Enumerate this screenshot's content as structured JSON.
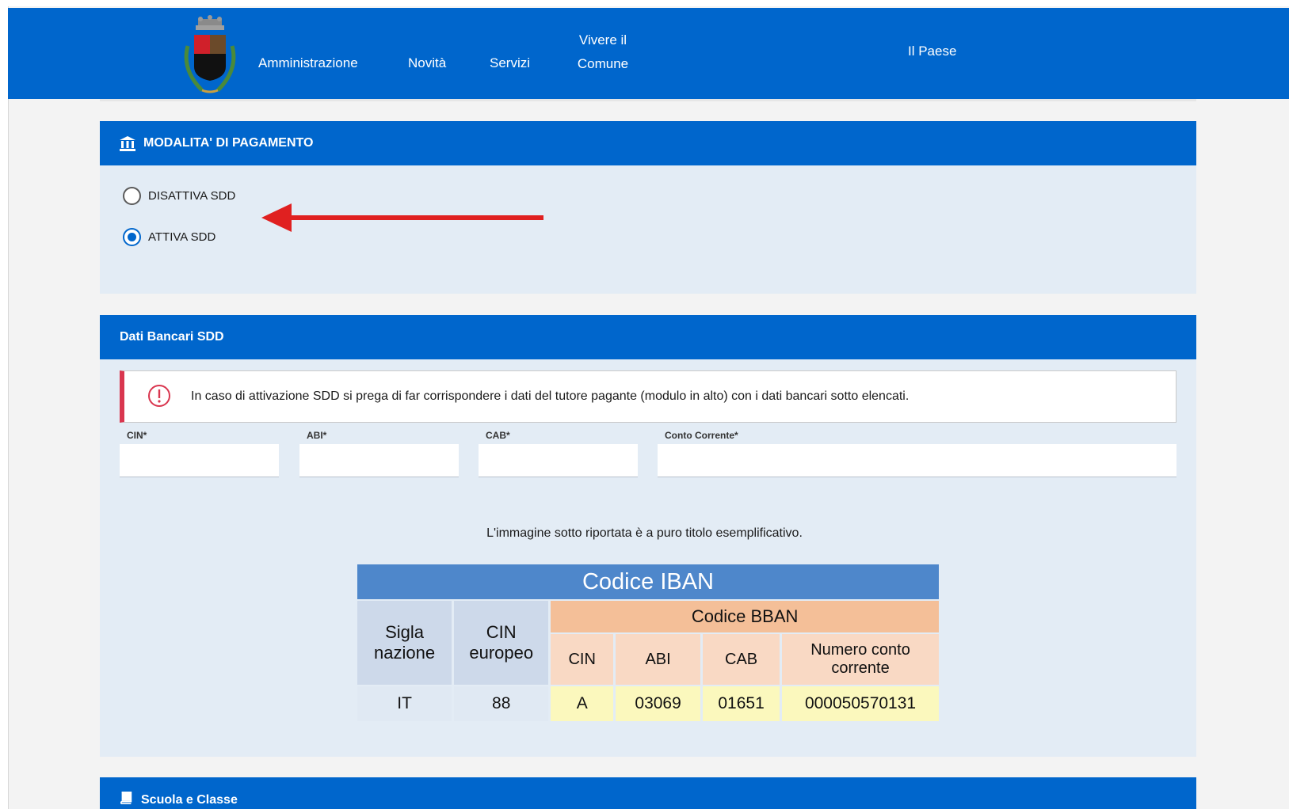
{
  "nav": {
    "items": [
      {
        "label": "Amministrazione"
      },
      {
        "label": "Novità"
      },
      {
        "label": "Servizi"
      },
      {
        "label": "Vivere il Comune"
      },
      {
        "label": "Il Paese"
      }
    ]
  },
  "payment": {
    "title": "MODALITA' DI PAGAMENTO",
    "options": [
      {
        "label": "DISATTIVA SDD",
        "checked": false
      },
      {
        "label": "ATTIVA SDD",
        "checked": true
      }
    ]
  },
  "bank": {
    "title": "Dati Bancari SDD",
    "alert": "In caso di attivazione SDD si prega di far corrispondere i dati del tutore pagante (modulo in alto) con i dati bancari sotto elencati.",
    "fields": [
      {
        "label": "CIN*",
        "value": ""
      },
      {
        "label": "ABI*",
        "value": ""
      },
      {
        "label": "CAB*",
        "value": ""
      },
      {
        "label": "Conto Corrente*",
        "value": ""
      }
    ],
    "caption": "L'immagine sotto riportata è a puro titolo esemplificativo.",
    "iban_table": {
      "title": "Codice IBAN",
      "sigla": "Sigla nazione",
      "cin_eu": "CIN europeo",
      "bban": "Codice BBAN",
      "cin": "CIN",
      "abi": "ABI",
      "cab": "CAB",
      "numero": "Numero conto corrente",
      "values": {
        "sigla": "IT",
        "cin_eu": "88",
        "cin": "A",
        "abi": "03069",
        "cab": "01651",
        "numero": "000050570131"
      }
    }
  },
  "school": {
    "title": "Scuola e Classe"
  },
  "colors": {
    "primary": "#0066cc",
    "panel_bg": "#e3ecf5",
    "alert_border": "#d9364f",
    "arrow": "#e02020"
  }
}
